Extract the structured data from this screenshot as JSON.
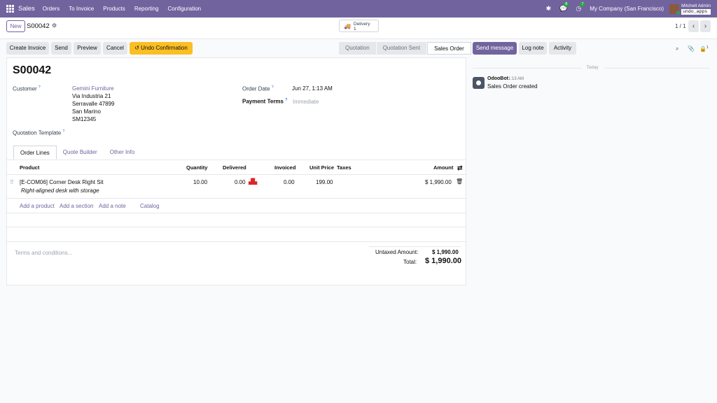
{
  "navbar": {
    "app": "Sales",
    "menu": [
      "Orders",
      "To Invoice",
      "Products",
      "Reporting",
      "Configuration"
    ],
    "messages_count": "8",
    "activities_count": "7",
    "company": "My Company (San Francisco)",
    "user": "Mitchell Admin",
    "database": "undo_apps"
  },
  "control": {
    "new_label": "New",
    "record_name": "S00042",
    "smart_button": {
      "label": "Delivery",
      "count": "1"
    },
    "pager": "1 / 1"
  },
  "actions": {
    "create_invoice": "Create Invoice",
    "send": "Send",
    "preview": "Preview",
    "cancel": "Cancel",
    "undo_confirmation": "Undo Confirmation"
  },
  "statusbar": [
    "Quotation",
    "Quotation Sent",
    "Sales Order"
  ],
  "form": {
    "title": "S00042",
    "customer_label": "Customer",
    "customer_name": "Gemini Furniture",
    "customer_address": [
      "Via Industria 21",
      "Serravalle 47899",
      "San Marino",
      "SM12345"
    ],
    "order_date_label": "Order Date",
    "order_date": "Jun 27, 1:13 AM",
    "payment_terms_label": "Payment Terms",
    "payment_terms_placeholder": "Immediate",
    "template_label": "Quotation Template",
    "tabs": [
      "Order Lines",
      "Quote Builder",
      "Other Info"
    ],
    "columns": [
      "Product",
      "Quantity",
      "Delivered",
      "Invoiced",
      "Unit Price",
      "Taxes",
      "Amount"
    ],
    "lines": [
      {
        "product": "[E-COM06] Corner Desk Right Sit",
        "description": "Right-aligned desk with storage",
        "quantity": "10.00",
        "delivered": "0.00",
        "invoiced": "0.00",
        "unit_price": "199.00",
        "taxes": "",
        "amount": "$ 1,990.00"
      }
    ],
    "add_links": [
      "Add a product",
      "Add a section",
      "Add a note",
      "Catalog"
    ],
    "terms_placeholder": "Terms and conditions...",
    "untaxed_label": "Untaxed Amount:",
    "untaxed_value": "$ 1,990.00",
    "total_label": "Total:",
    "total_value": "$ 1,990.00"
  },
  "chatter": {
    "send_message": "Send message",
    "log_note": "Log note",
    "activity": "Activity",
    "followers_count": "1",
    "date_separator": "Today",
    "messages": [
      {
        "author": "OdooBot",
        "time": "1:13 AM",
        "body": "Sales Order created"
      }
    ]
  },
  "colors": {
    "brand": "#71639e",
    "warning": "#fbbf24",
    "badge": "#28a745"
  }
}
